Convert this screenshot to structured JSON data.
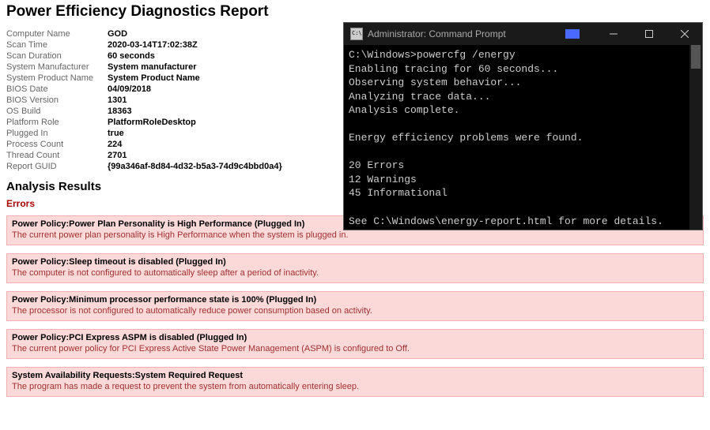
{
  "report": {
    "title": "Power Efficiency Diagnostics Report",
    "fields": [
      {
        "label": "Computer Name",
        "value": "GOD"
      },
      {
        "label": "Scan Time",
        "value": "2020-03-14T17:02:38Z"
      },
      {
        "label": "Scan Duration",
        "value": "60 seconds"
      },
      {
        "label": "System Manufacturer",
        "value": "System manufacturer"
      },
      {
        "label": "System Product Name",
        "value": "System Product Name"
      },
      {
        "label": "BIOS Date",
        "value": "04/09/2018"
      },
      {
        "label": "BIOS Version",
        "value": "1301"
      },
      {
        "label": "OS Build",
        "value": "18363"
      },
      {
        "label": "Platform Role",
        "value": "PlatformRoleDesktop"
      },
      {
        "label": "Plugged In",
        "value": "true"
      },
      {
        "label": "Process Count",
        "value": "224"
      },
      {
        "label": "Thread Count",
        "value": "2701"
      },
      {
        "label": "Report GUID",
        "value": "{99a346af-8d84-4d32-b5a3-74d9c4bbd0a4}"
      }
    ],
    "analysis_heading": "Analysis Results",
    "errors_heading": "Errors",
    "errors": [
      {
        "title": "Power Policy:Power Plan Personality is High Performance (Plugged In)",
        "desc": "The current power plan personality is High Performance when the system is plugged in."
      },
      {
        "title": "Power Policy:Sleep timeout is disabled (Plugged In)",
        "desc": "The computer is not configured to automatically sleep after a period of inactivity."
      },
      {
        "title": "Power Policy:Minimum processor performance state is 100% (Plugged In)",
        "desc": "The processor is not configured to automatically reduce power consumption based on activity."
      },
      {
        "title": "Power Policy:PCI Express ASPM is disabled (Plugged In)",
        "desc": "The current power policy for PCI Express Active State Power Management (ASPM) is configured to Off."
      },
      {
        "title": "System Availability Requests:System Required Request",
        "desc": "The program has made a request to prevent the system from automatically entering sleep."
      }
    ]
  },
  "cmd": {
    "title": "Administrator: Command Prompt",
    "lines": [
      "C:\\Windows>powercfg /energy",
      "Enabling tracing for 60 seconds...",
      "Observing system behavior...",
      "Analyzing trace data...",
      "Analysis complete.",
      "",
      "Energy efficiency problems were found.",
      "",
      "20 Errors",
      "12 Warnings",
      "45 Informational",
      "",
      "See C:\\Windows\\energy-report.html for more details."
    ]
  }
}
